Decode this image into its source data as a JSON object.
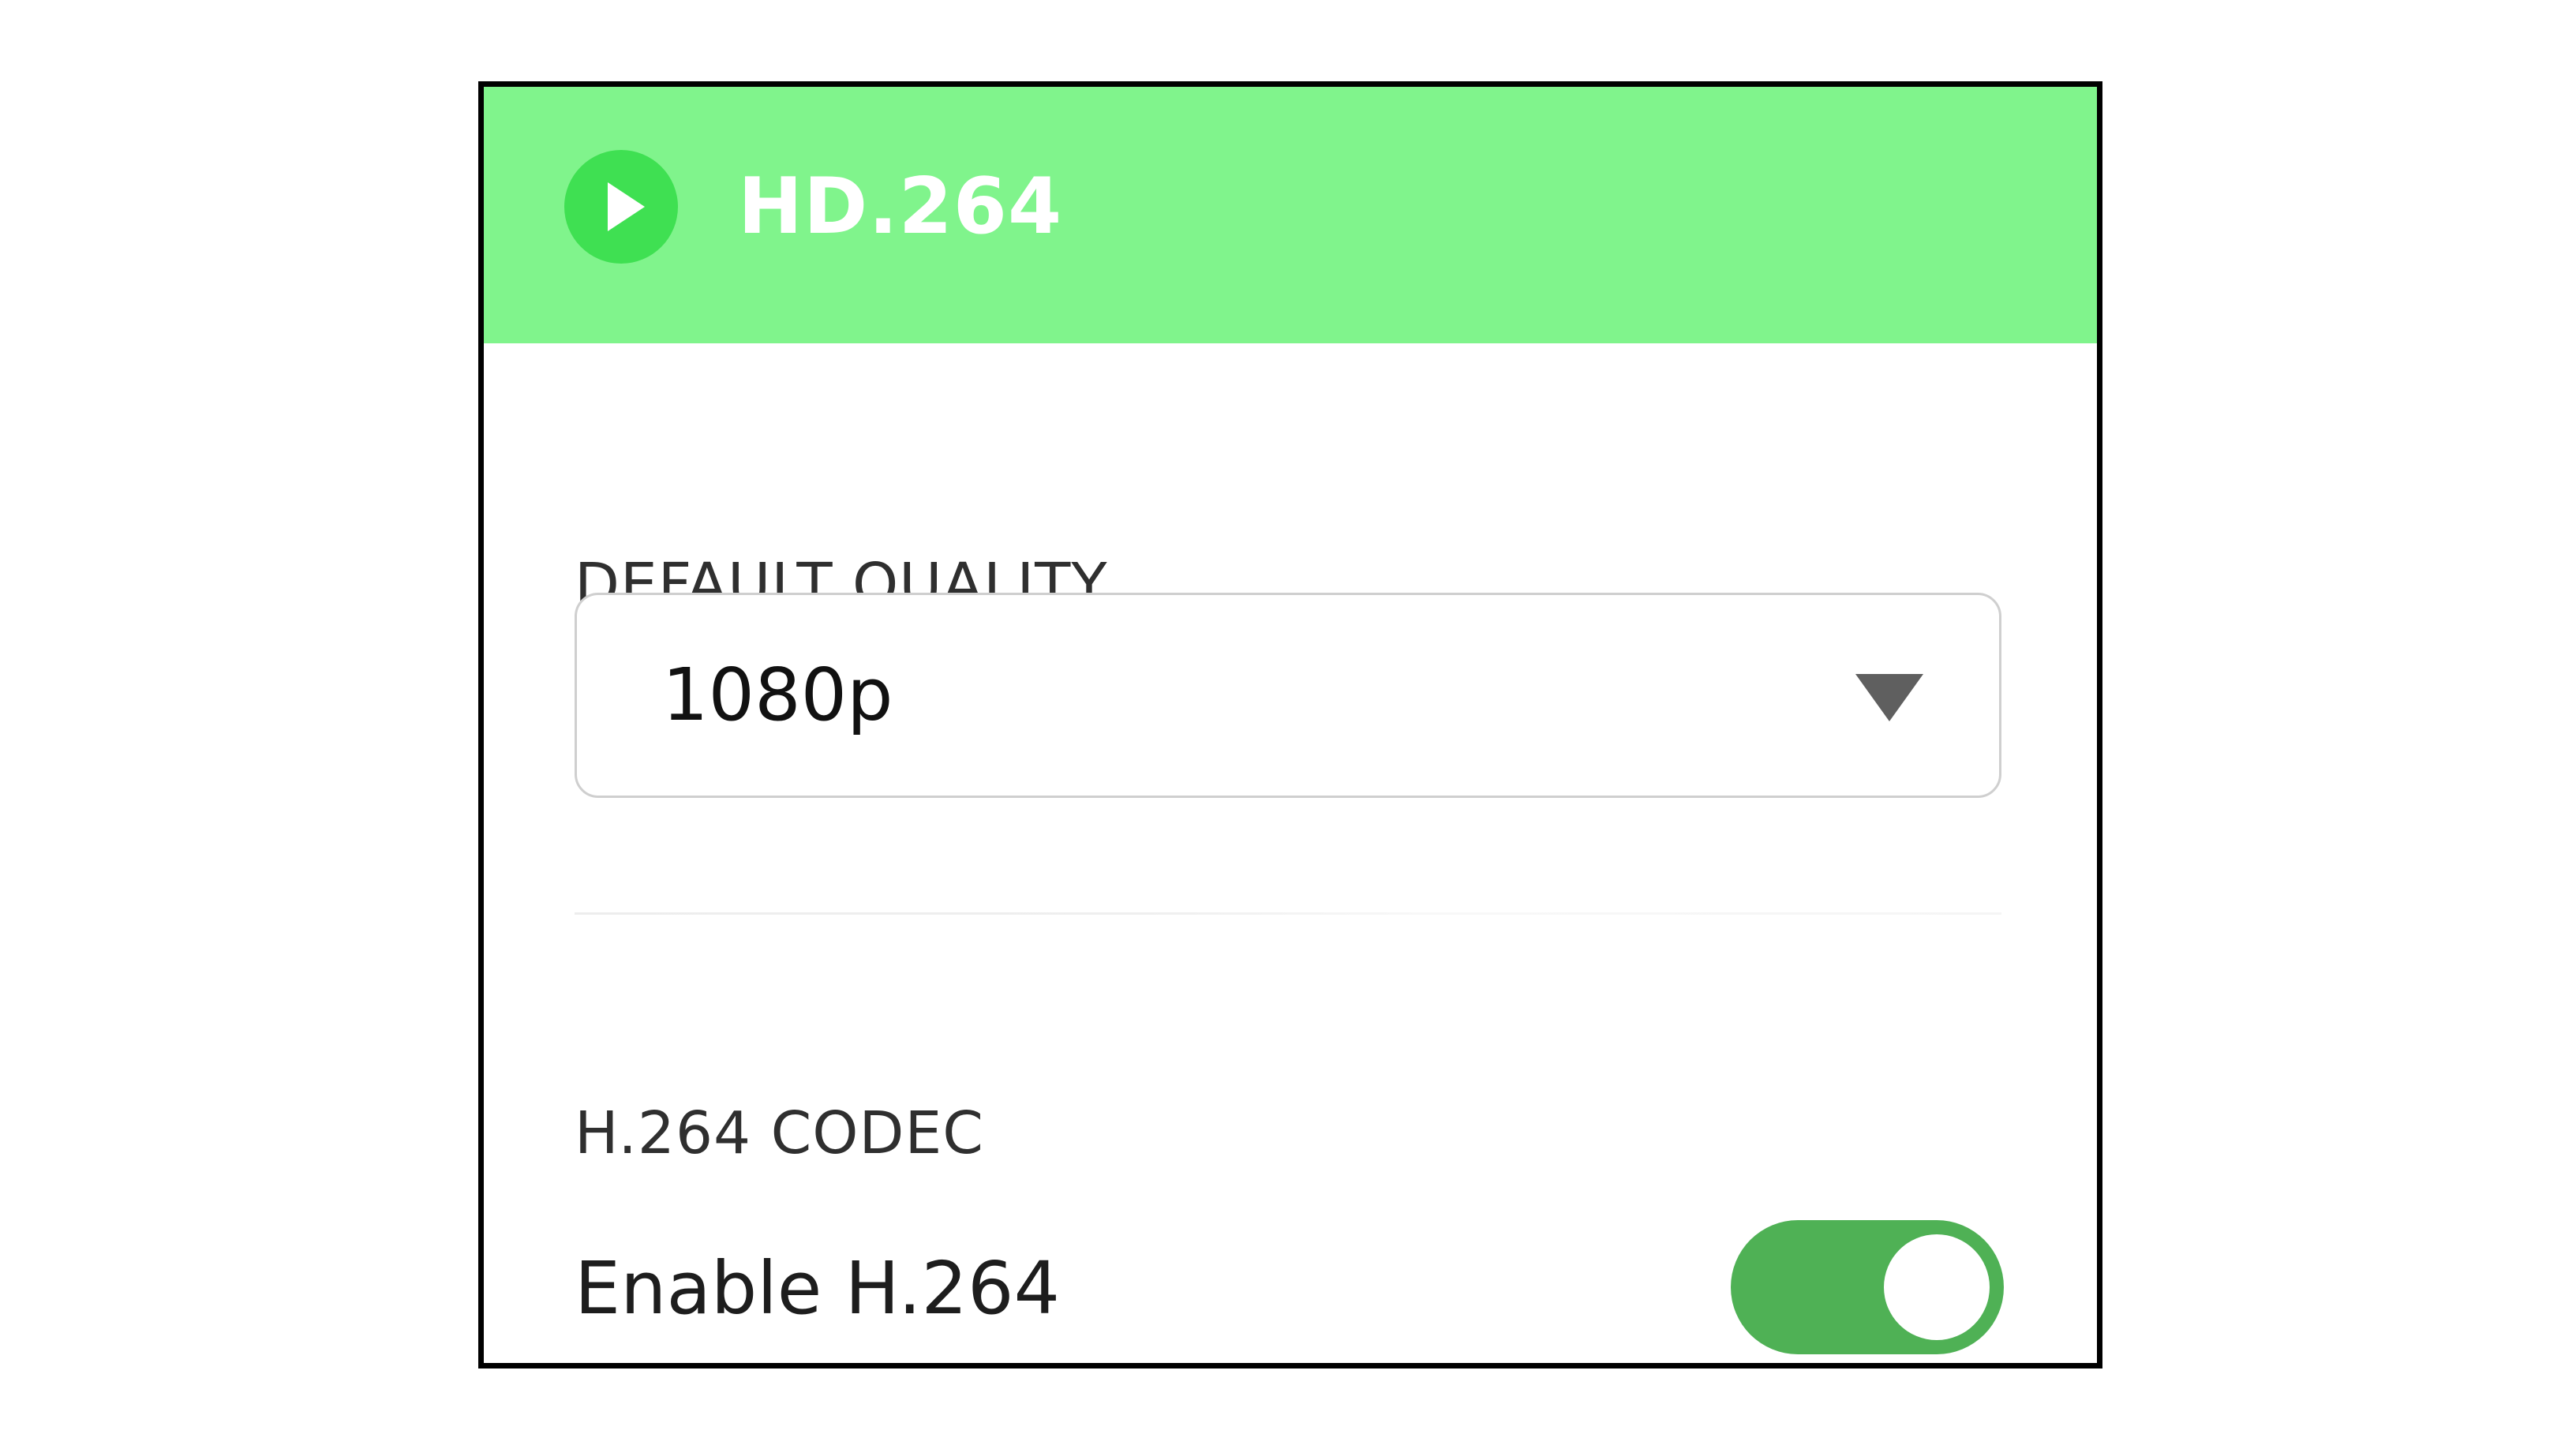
{
  "header": {
    "title": "HD.264",
    "icon": "play-icon",
    "background_color": "#80f48c",
    "icon_circle_color": "#3fe052"
  },
  "quality": {
    "label": "DEFAULT QUALITY",
    "selected_value": "1080p",
    "dropdown_icon": "triangle-down-icon",
    "dropdown_icon_color": "#5f5f5f"
  },
  "codec": {
    "label": "H.264 CODEC",
    "toggle_label": "Enable H.264",
    "toggle_on": true,
    "toggle_color": "#4fb155"
  }
}
